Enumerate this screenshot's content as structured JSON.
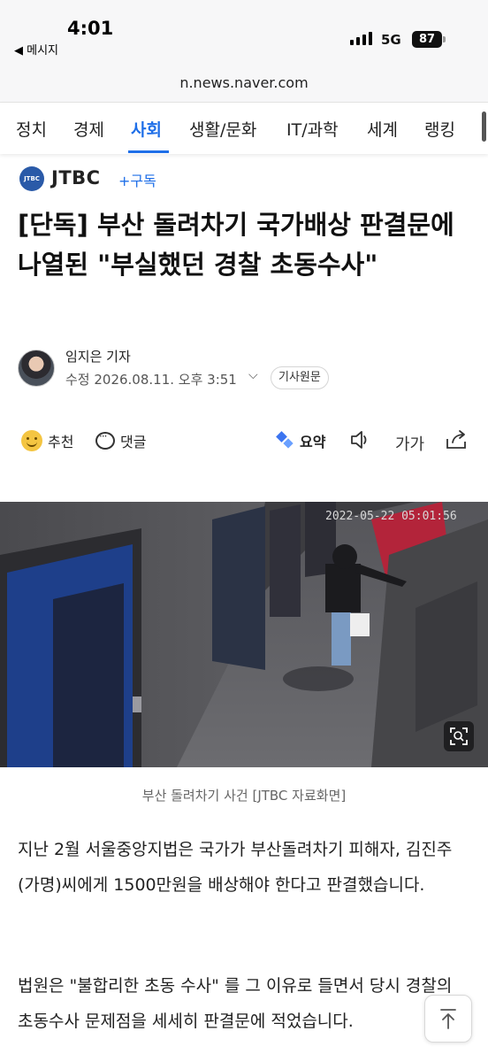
{
  "status_bar": {
    "time": "4:01",
    "back_app": "◀ 메시지",
    "network": "5G",
    "battery": "87"
  },
  "browser": {
    "url": "n.news.naver.com"
  },
  "nav": {
    "items": [
      "정치",
      "경제",
      "사회",
      "생활/문화",
      "IT/과학",
      "세계",
      "랭킹"
    ],
    "active": "사회"
  },
  "press": {
    "logo_text": "JTBC news",
    "name": "JTBC",
    "subscribe": "+구독"
  },
  "article": {
    "headline": "[단독] 부산 돌려차기 국가배상 판결문에 나열된 \"부실했던 경찰 초동수사\"",
    "reporter": "임지은 기자",
    "date": "수정 2026.08.11. 오후 3:51",
    "origin_button": "기사원문",
    "image_timestamp": "2022-05-22 05:01:56",
    "caption": "부산 돌려차기 사건 [JTBC 자료화면]",
    "paragraphs": [
      "지난 2월 서울중앙지법은 국가가 부산돌려차기 피해자, 김진주(가명)씨에게 1500만원을 배상해야 한다고 판결했습니다.",
      "법원은 \"불합리한 초동 수사\" 를 그 이유로 들면서 당시 경찰의 초동수사 문제점을 세세히 판결문에 적었습니다."
    ]
  },
  "actions": {
    "recommend": "추천",
    "comment": "댓글",
    "summary": "요약",
    "font_size": "가가"
  },
  "colors": {
    "accent": "#1f6fe8",
    "press_logo": "#2a5aa8"
  }
}
